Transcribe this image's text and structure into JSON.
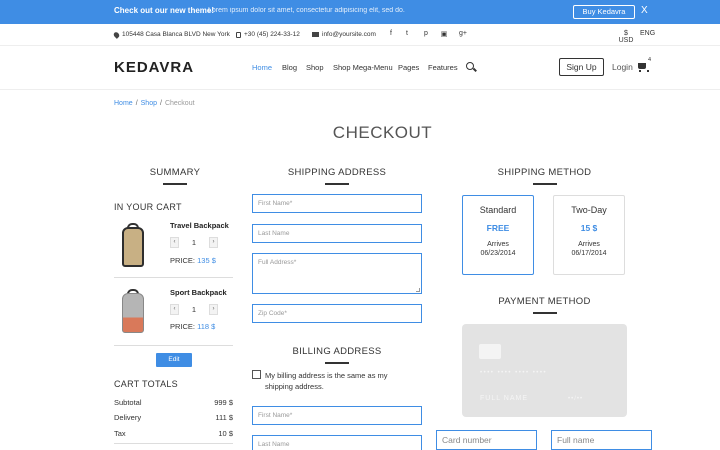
{
  "promo": {
    "title": "Check out our new theme!",
    "text": "Lorem ipsum dolor sit amet, consectetur adipisicing elit, sed do.",
    "button": "Buy Kedavra",
    "close": "X"
  },
  "info": {
    "address": "105448 Casa Blanca BLVD New York",
    "phone": "+30 (45) 224-33-12",
    "email": "info@yoursite.com",
    "social_icons": [
      "facebook-icon",
      "twitter-icon",
      "pinterest-icon",
      "youtube-icon",
      "google-plus-icon"
    ],
    "social_glyphs": [
      "f",
      "t",
      "p",
      "▣",
      "g+"
    ],
    "currency": "$ USD",
    "language": "ENG"
  },
  "header": {
    "logo": "KEDAVRA",
    "nav": [
      "Home",
      "Blog",
      "Shop",
      "Shop Mega-Menu",
      "Pages",
      "Features"
    ],
    "active_nav": "Home",
    "signup": "Sign Up",
    "login": "Login",
    "cart_count": "4"
  },
  "breadcrumb": {
    "home": "Home",
    "shop": "Shop",
    "current": "Checkout",
    "sep": "/"
  },
  "page_title": "CHECKOUT",
  "summary": {
    "heading": "SUMMARY",
    "in_cart": "IN YOUR CART",
    "items": [
      {
        "name": "Travel Backpack",
        "qty": "1",
        "price_label": "PRICE:",
        "price": "135 $"
      },
      {
        "name": "Sport Backpack",
        "qty": "1",
        "price_label": "PRICE:",
        "price": "118 $"
      }
    ],
    "edit": "Edit",
    "totals_heading": "CART TOTALS",
    "totals": [
      {
        "label": "Subtotal",
        "value": "999 $"
      },
      {
        "label": "Delivery",
        "value": "111 $"
      },
      {
        "label": "Tax",
        "value": "10 $"
      }
    ]
  },
  "shipping_address": {
    "heading": "SHIPPING ADDRESS",
    "first_name": "First Name*",
    "last_name": "Last Name",
    "full_address": "Full Address*",
    "zip": "Zip Code*"
  },
  "billing_address": {
    "heading": "BILLING ADDRESS",
    "same_label": "My billing address is the same as my shipping address.",
    "first_name": "First Name*",
    "last_name": "Last Name"
  },
  "shipping_method": {
    "heading": "SHIPPING METHOD",
    "options": [
      {
        "name": "Standard",
        "price": "FREE",
        "arrives": "Arrives",
        "date": "06/23/2014",
        "selected": true
      },
      {
        "name": "Two-Day",
        "price": "15 $",
        "arrives": "Arrives",
        "date": "06/17/2014",
        "selected": false
      }
    ]
  },
  "payment": {
    "heading": "PAYMENT METHOD",
    "card_number_mask": "•••• •••• •••• ••••",
    "card_name": "FULL NAME",
    "card_expiry": "••/••",
    "card_number_placeholder": "Card number",
    "full_name_placeholder": "Full name"
  },
  "colors": {
    "accent": "#3f8de4",
    "text": "#333333",
    "card": "#e3e3e3"
  }
}
